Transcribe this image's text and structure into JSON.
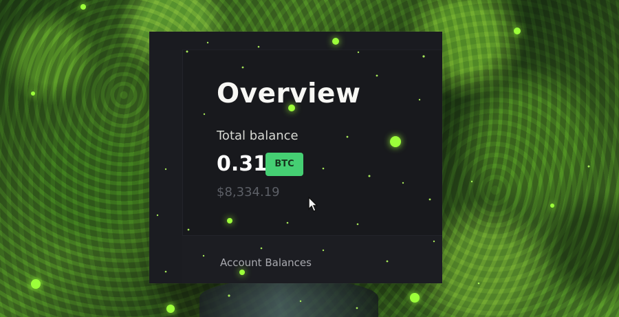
{
  "overview": {
    "title": "Overview",
    "total_balance_label": "Total balance",
    "balance": "0.31",
    "currency": "BTC",
    "fiat_value": "$8,334.19",
    "account_balances_label": "Account Balances"
  },
  "icons": {
    "cursor": "mouse-pointer-icon",
    "particles": "glowing-particle-icon"
  },
  "colors": {
    "panel": "#18191d",
    "accent": "#45cf73",
    "particle": "#9cff3a",
    "text_primary": "#ffffff",
    "text_muted": "#5c5f66"
  }
}
